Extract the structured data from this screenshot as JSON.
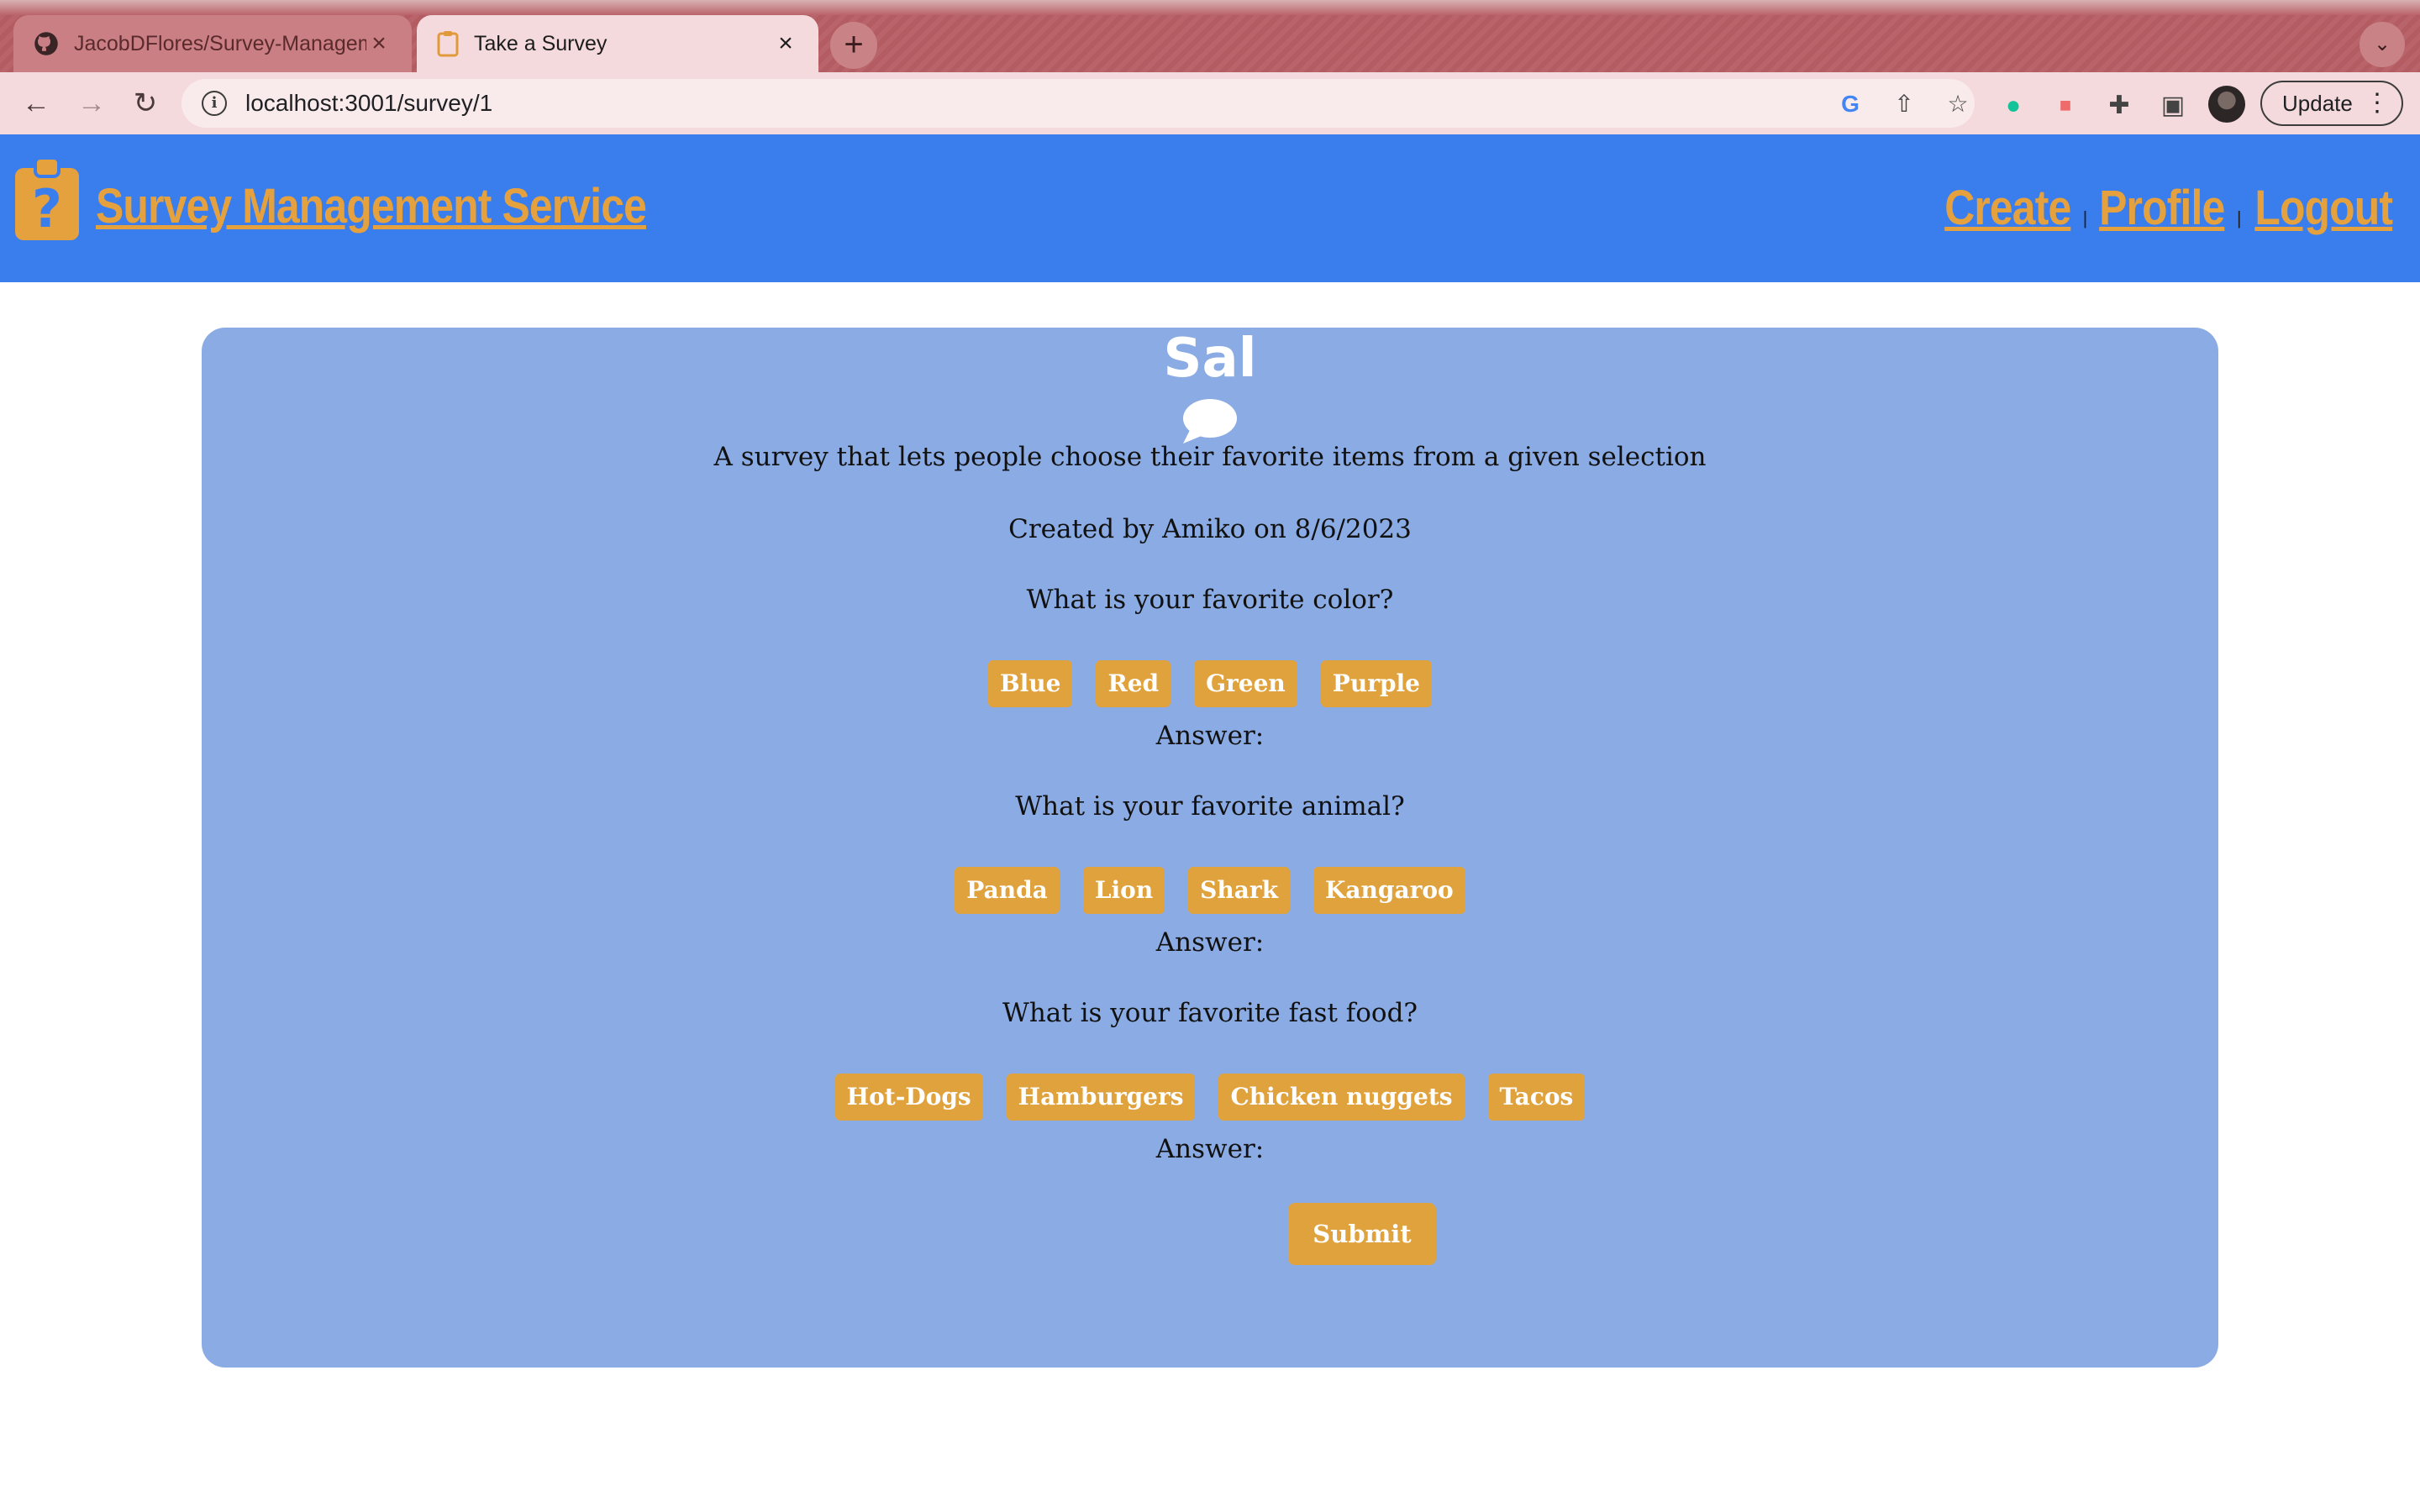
{
  "browser": {
    "tabs": [
      {
        "title": "JacobDFlores/Survey-Management-Service",
        "icon": "github-icon"
      },
      {
        "title": "Take a Survey",
        "icon": "clipboard-icon"
      }
    ],
    "url": "localhost:3001/survey/1",
    "update_label": "Update"
  },
  "header": {
    "title": "Survey Management Service",
    "nav": {
      "create": "Create",
      "profile": "Profile",
      "logout": "Logout",
      "separator": "|"
    },
    "colors": {
      "background": "#3a7eed",
      "accent": "#e4a13e"
    }
  },
  "survey": {
    "title": "Sal",
    "description": "A survey that lets people choose their favorite items from a given selection",
    "meta": "Created by Amiko on 8/6/2023",
    "answer_label": "Answer:",
    "questions": [
      {
        "text": "What is your favorite color?",
        "options": [
          "Blue",
          "Red",
          "Green",
          "Purple"
        ]
      },
      {
        "text": "What is your favorite animal?",
        "options": [
          "Panda",
          "Lion",
          "Shark",
          "Kangaroo"
        ]
      },
      {
        "text": "What is your favorite fast food?",
        "options": [
          "Hot-Dogs",
          "Hamburgers",
          "Chicken nuggets",
          "Tacos"
        ]
      }
    ],
    "submit_label": "Submit",
    "colors": {
      "card": "#8aabe3",
      "button": "#e0a23d"
    }
  }
}
